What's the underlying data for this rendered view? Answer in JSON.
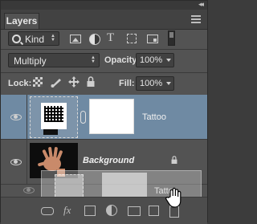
{
  "panel": {
    "title": "Layers",
    "collapse_glyph": "◂◂",
    "close_glyph": "✕"
  },
  "filter": {
    "kind_label": "Kind"
  },
  "blend": {
    "mode": "Multiply",
    "opacity_label": "Opacity:",
    "opacity_value": "100%",
    "lock_label": "Lock:",
    "fill_label": "Fill:",
    "fill_value": "100%"
  },
  "layers": [
    {
      "name": "Tattoo",
      "visible": true,
      "selected": true,
      "has_mask": true
    },
    {
      "name": "Background",
      "visible": true,
      "selected": false,
      "locked": true
    }
  ],
  "drag_ghost": {
    "name": "Tattoo"
  },
  "colors": {
    "panel_bg": "#535353",
    "selected_layer": "#6f8aa3",
    "titlebar": "#393939"
  }
}
